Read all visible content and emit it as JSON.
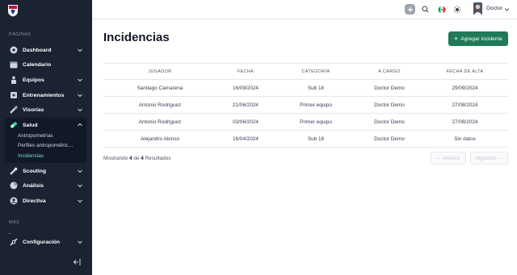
{
  "sidebar": {
    "section_pages": "PÁGINAS",
    "section_more": "MÁS",
    "items": [
      {
        "label": "Dashboard",
        "icon": "dashboard-icon"
      },
      {
        "label": "Calendario",
        "icon": "calendar-icon"
      },
      {
        "label": "Equipos",
        "icon": "team-icon"
      },
      {
        "label": "Entrenamientos",
        "icon": "training-icon"
      },
      {
        "label": "Visorías",
        "icon": "scouting-visits-icon"
      },
      {
        "label": "Salud",
        "icon": "health-icon"
      },
      {
        "label": "Scouting",
        "icon": "scouting-icon"
      },
      {
        "label": "Análisis",
        "icon": "analysis-icon"
      },
      {
        "label": "Directiva",
        "icon": "board-icon"
      },
      {
        "label": "Configuración",
        "icon": "settings-icon"
      }
    ],
    "salud_sub": [
      "Antropometrías",
      "Perfiles antropométric…",
      "Incidencias"
    ]
  },
  "header": {
    "user_name": "Doctor"
  },
  "main": {
    "title": "Incidencias",
    "add_button": "Agregar incidente",
    "columns": [
      "JUGADOR",
      "FECHA",
      "CATEGORÍA",
      "A CARGO",
      "FECHA DE ALTA"
    ],
    "rows": [
      [
        "Santiago Camarena",
        "16/09/2024",
        "Sub 18",
        "Doctor Demo",
        "29/09/2024"
      ],
      [
        "Antonio Rodriguez",
        "21/06/2024",
        "Primer equipo",
        "Doctor Demo",
        "27/08/2024"
      ],
      [
        "Antonio Rodriguez",
        "03/06/2024",
        "Primer equipo",
        "Doctor Demo",
        "27/08/2024"
      ],
      [
        "Alejandro Alonso",
        "16/04/2024",
        "Sub 18",
        "Doctor Demo",
        "Sin datos"
      ]
    ],
    "summary": {
      "prefix": "Mostrando",
      "from": "4",
      "of_word": "de",
      "total": "4",
      "suffix": "Resultados"
    },
    "prev_label": "← Anterior",
    "next_label": "Siguiente →"
  },
  "colors": {
    "sidebar_bg": "#1b2232",
    "accent": "#1f7a55",
    "active_sub": "#6ee7b7"
  }
}
